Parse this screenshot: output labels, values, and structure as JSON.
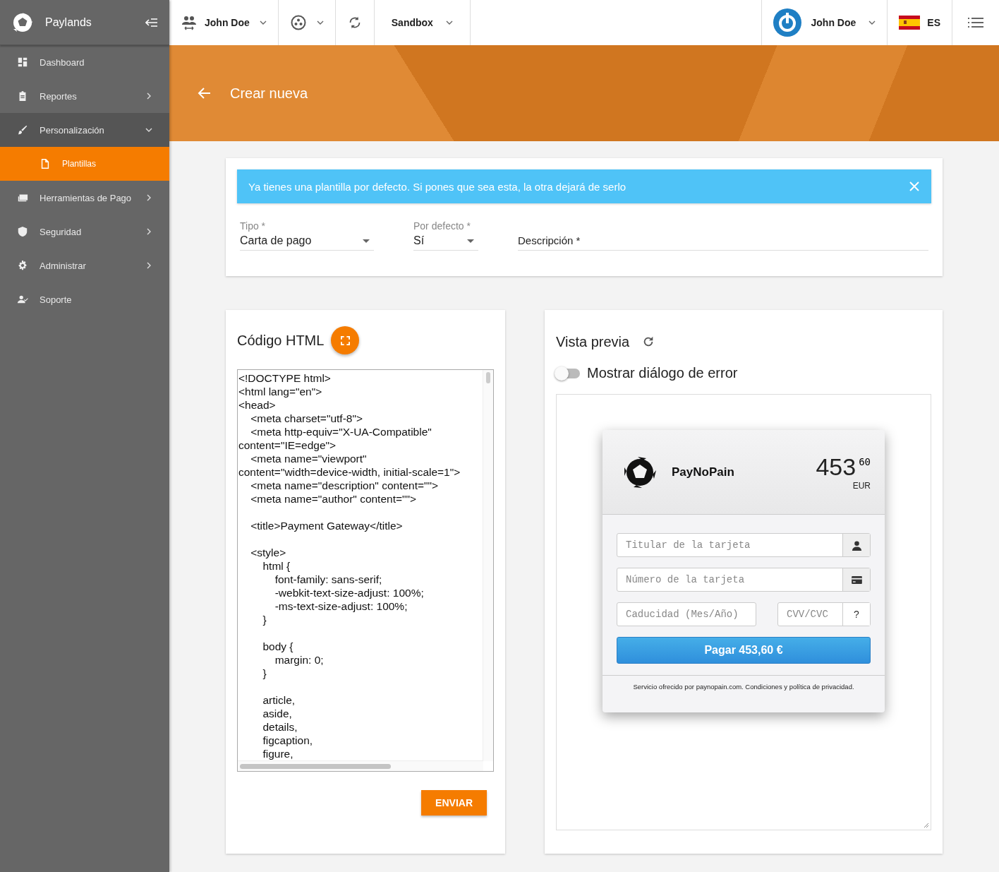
{
  "sidebar": {
    "brand": "Paylands",
    "items": [
      {
        "label": "Dashboard",
        "kind": "link",
        "selected": false
      },
      {
        "label": "Reportes",
        "kind": "group",
        "expanded": false,
        "selected": false
      },
      {
        "label": "Personalización",
        "kind": "group",
        "expanded": true,
        "selected": false,
        "children": [
          {
            "label": "Plantillas",
            "selected": true
          }
        ]
      },
      {
        "label": "Herramientas de Pago",
        "kind": "group",
        "expanded": false,
        "selected": false
      },
      {
        "label": "Seguridad",
        "kind": "group",
        "expanded": false,
        "selected": false
      },
      {
        "label": "Administrar",
        "kind": "group",
        "expanded": false,
        "selected": false
      },
      {
        "label": "Soporte",
        "kind": "link",
        "selected": false
      }
    ]
  },
  "topbar": {
    "account": "John Doe",
    "environment": "Sandbox",
    "user": "John Doe",
    "language": "ES"
  },
  "header": {
    "title": "Crear nueva"
  },
  "alert": {
    "message": "Ya tienes una plantilla por defecto. Si pones que sea esta, la otra dejará de serlo"
  },
  "form": {
    "tipo": {
      "label": "Tipo",
      "required": "*",
      "value": "Carta de pago"
    },
    "por_defecto": {
      "label": "Por defecto",
      "required": "*",
      "value": "Sí"
    },
    "descripcion": {
      "placeholder": "Descripción",
      "required": "*"
    }
  },
  "code_panel": {
    "title": "Código HTML",
    "lines": [
      {
        "text": "<!DOCTYPE html>",
        "blank_before": false
      },
      {
        "text": "<html lang=\"en\">",
        "blank_before": false
      },
      {
        "text": "<head>",
        "blank_before": false
      },
      {
        "text": "    <meta charset=\"utf-8\">",
        "blank_before": false
      },
      {
        "text": "    <meta http-equiv=\"X-UA-Compatible\"",
        "blank_before": false
      },
      {
        "text": "content=\"IE=edge\">",
        "blank_before": false
      },
      {
        "text": "    <meta name=\"viewport\"",
        "blank_before": false
      },
      {
        "text": "content=\"width=device-width, initial-scale=1\">",
        "blank_before": false
      },
      {
        "text": "    <meta name=\"description\" content=\"\">",
        "blank_before": false
      },
      {
        "text": "    <meta name=\"author\" content=\"\">",
        "blank_before": false
      },
      {
        "text": "    <title>Payment Gateway</title>",
        "blank_before": true
      },
      {
        "text": "    <style>",
        "blank_before": true
      },
      {
        "text": "        html {",
        "blank_before": false
      },
      {
        "text": "            font-family: sans-serif;",
        "blank_before": false
      },
      {
        "text": "            -webkit-text-size-adjust: 100%;",
        "blank_before": false
      },
      {
        "text": "            -ms-text-size-adjust: 100%;",
        "blank_before": false
      },
      {
        "text": "        }",
        "blank_before": false
      },
      {
        "text": "        body {",
        "blank_before": true
      },
      {
        "text": "            margin: 0;",
        "blank_before": false
      },
      {
        "text": "        }",
        "blank_before": false
      },
      {
        "text": "        article,",
        "blank_before": true
      },
      {
        "text": "        aside,",
        "blank_before": false
      },
      {
        "text": "        details,",
        "blank_before": false
      },
      {
        "text": "        figcaption,",
        "blank_before": false
      },
      {
        "text": "        figure,",
        "blank_before": false
      }
    ],
    "submit": "ENVIAR"
  },
  "preview": {
    "title": "Vista previa",
    "error_toggle": {
      "label": "Mostrar diálogo de error",
      "on": false
    },
    "payment": {
      "merchant": "PayNoPain",
      "amount": "453",
      "cents": "60",
      "currency": "EUR",
      "holder_placeholder": "Titular de la tarjeta",
      "number_placeholder": "Número de la tarjeta",
      "expiry_placeholder": "Caducidad (Mes/Año)",
      "cvv_placeholder": "CVV/CVC",
      "cvv_help": "?",
      "pay_button": "Pagar 453,60 €",
      "footer": "Servicio ofrecido por paynopain.com. Condiciones y política de privacidad."
    }
  }
}
